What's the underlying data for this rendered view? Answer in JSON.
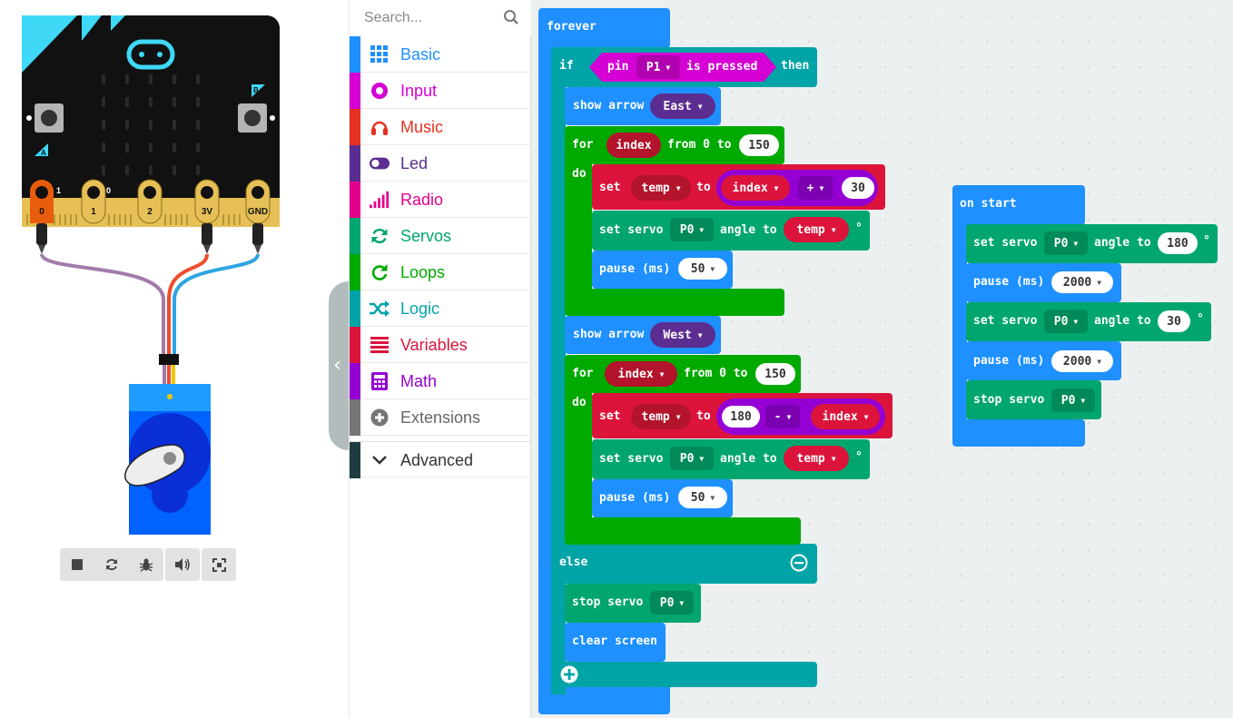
{
  "toolbox": {
    "search_placeholder": "Search...",
    "categories": [
      {
        "label": "Basic",
        "color": "#1e90ff",
        "icon": "grid-icon"
      },
      {
        "label": "Input",
        "color": "#d400d4",
        "icon": "circle-icon"
      },
      {
        "label": "Music",
        "color": "#e63022",
        "icon": "headphones-icon"
      },
      {
        "label": "Led",
        "color": "#5c2d91",
        "icon": "toggle-icon"
      },
      {
        "label": "Radio",
        "color": "#e3008c",
        "icon": "signal-bars-icon"
      },
      {
        "label": "Servos",
        "color": "#00a4a6",
        "icon": "refresh-icon"
      },
      {
        "label": "Loops",
        "color": "#00aa00",
        "icon": "loop-icon"
      },
      {
        "label": "Logic",
        "color": "#00a4a6",
        "icon": "shuffle-icon"
      },
      {
        "label": "Variables",
        "color": "#dc143c",
        "icon": "list-icon"
      },
      {
        "label": "Math",
        "color": "#9400d3",
        "icon": "calculator-icon"
      },
      {
        "label": "Extensions",
        "color": "#757575",
        "icon": "plus-circle-icon"
      },
      {
        "label": "Advanced",
        "color": "#333333",
        "icon": "chevron-down-icon"
      }
    ]
  },
  "simulator": {
    "pins": [
      "0",
      "1",
      "2",
      "3V",
      "GND"
    ],
    "pin_values": [
      "1",
      "0"
    ],
    "button_a": "A",
    "button_b": "B",
    "toolbar": [
      "stop-icon",
      "restart-icon",
      "debug-icon",
      "sound-icon",
      "fullscreen-icon"
    ]
  },
  "blocks": {
    "forever": {
      "label": "forever",
      "if_kw": "if",
      "pin_kw": "pin",
      "pin": "P1",
      "pressed": "is pressed",
      "then_kw": "then",
      "else_kw": "else",
      "show_arrow_1": {
        "label": "show arrow",
        "dir": "East"
      },
      "for_1": {
        "for_kw": "for",
        "var": "index",
        "from": "from 0 to",
        "to": "150",
        "do_kw": "do"
      },
      "set_1": {
        "set_kw": "set",
        "var": "temp",
        "to_kw": "to",
        "left": "index",
        "op": "+",
        "right": "30"
      },
      "servo_1": {
        "label": "set servo",
        "pin": "P0",
        "angle_kw": "angle to",
        "value": "temp",
        "deg": "°"
      },
      "pause_1": {
        "label": "pause (ms)",
        "value": "50"
      },
      "show_arrow_2": {
        "label": "show arrow",
        "dir": "West"
      },
      "for_2": {
        "for_kw": "for",
        "var": "index",
        "from": "from 0 to",
        "to": "150",
        "do_kw": "do"
      },
      "set_2": {
        "set_kw": "set",
        "var": "temp",
        "to_kw": "to",
        "left": "180",
        "op": "-",
        "right": "index"
      },
      "servo_2": {
        "label": "set servo",
        "pin": "P0",
        "angle_kw": "angle to",
        "value": "temp",
        "deg": "°"
      },
      "pause_2": {
        "label": "pause (ms)",
        "value": "50"
      },
      "stop_servo": {
        "label": "stop servo",
        "pin": "P0"
      },
      "clear_screen": "clear screen"
    },
    "on_start": {
      "label": "on start",
      "servo_1": {
        "label": "set servo",
        "pin": "P0",
        "angle_kw": "angle to",
        "value": "180",
        "deg": "°"
      },
      "pause_1": {
        "label": "pause (ms)",
        "value": "2000"
      },
      "servo_2": {
        "label": "set servo",
        "pin": "P0",
        "angle_kw": "angle to",
        "value": "30",
        "deg": "°"
      },
      "pause_2": {
        "label": "pause (ms)",
        "value": "2000"
      },
      "stop_servo": {
        "label": "stop servo",
        "pin": "P0"
      }
    }
  }
}
